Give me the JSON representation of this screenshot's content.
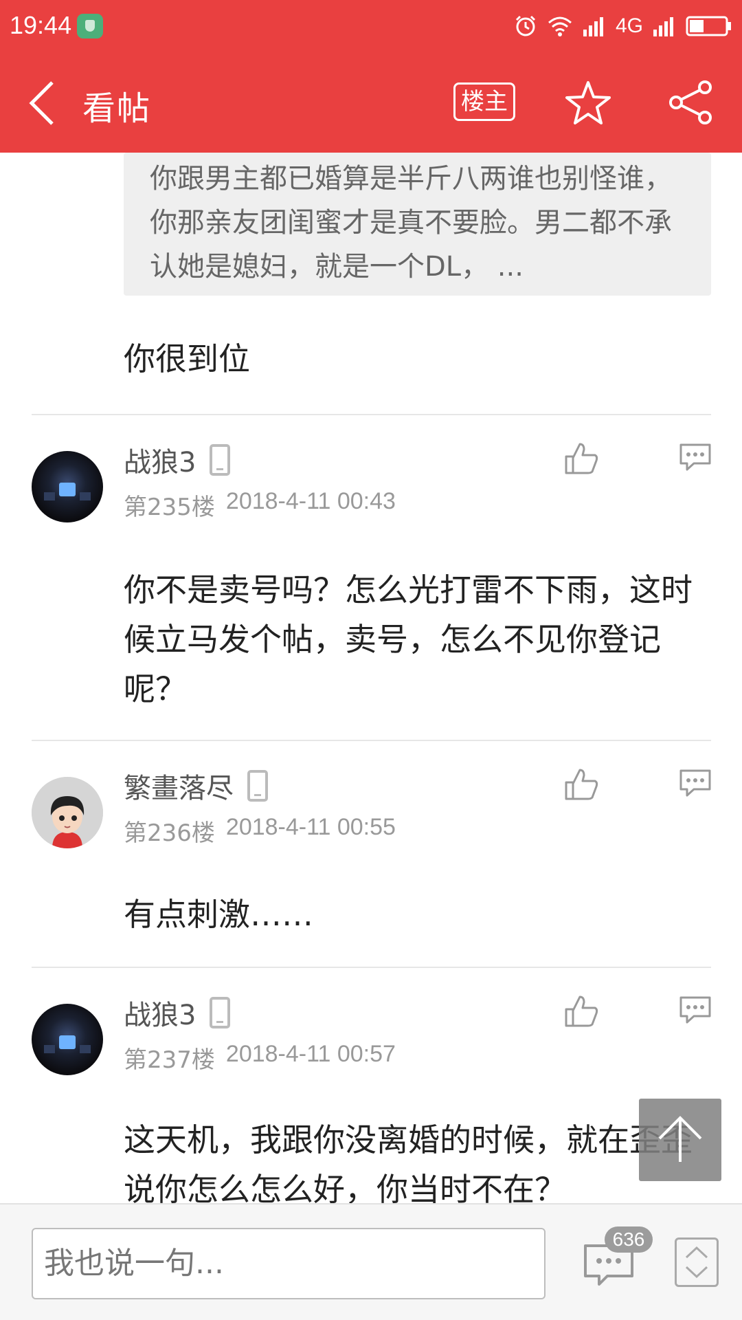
{
  "status_bar": {
    "time": "19:44",
    "network": "4G"
  },
  "nav": {
    "title": "看帖",
    "owner_label": "楼主"
  },
  "quoted": {
    "text": "你跟男主都已婚算是半斤八两谁也别怪谁，你那亲友团闺蜜才是真不要脸。男二都不承认她是媳妇，就是一个DL，  ..."
  },
  "first_reply_text": "你很到位",
  "posts": [
    {
      "username": "战狼3",
      "floor": "第235楼",
      "date": "2018-4-11 00:43",
      "text": "你不是卖号吗？怎么光打雷不下雨，这时候立马发个帖，卖号，怎么不见你登记呢？"
    },
    {
      "username": "繁畫落尽",
      "floor": "第236楼",
      "date": "2018-4-11 00:55",
      "text": "有点刺激……"
    },
    {
      "username": "战狼3",
      "floor": "第237楼",
      "date": "2018-4-11 00:57",
      "text": "这天机，我跟你没离婚的时候，就在歪歪说你怎么怎么好，你当时不在？"
    }
  ],
  "bottom": {
    "input_placeholder": "我也说一句...",
    "comment_count": "636"
  },
  "colors": {
    "header": "#e94040"
  }
}
